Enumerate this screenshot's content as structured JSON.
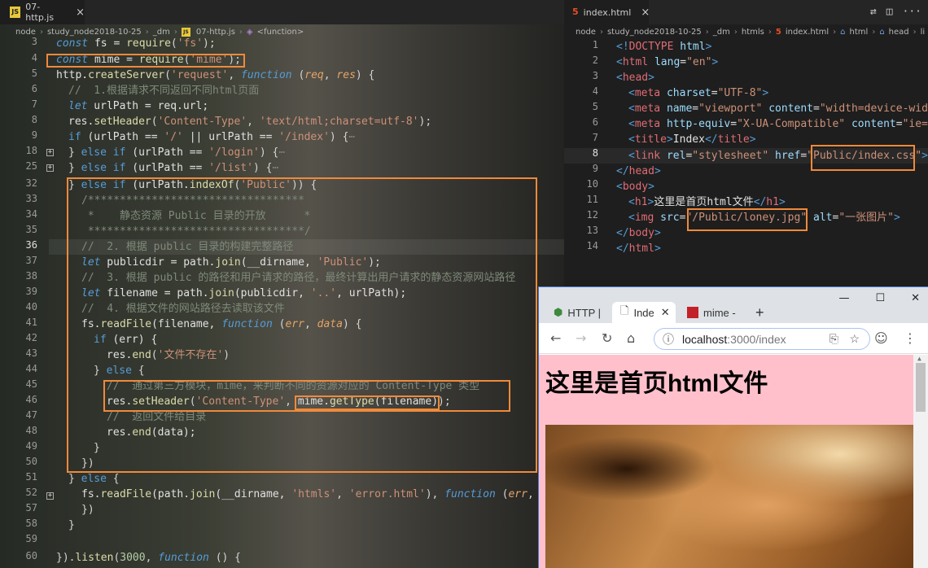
{
  "left_editor": {
    "tab": {
      "icon": "JS",
      "label": "07-http.js",
      "close": "×"
    },
    "breadcrumb": [
      "node",
      "study_node2018-10-25",
      "_dm",
      "07-http.js",
      "<function>"
    ],
    "lines": [
      {
        "n": "3"
      },
      {
        "n": "4"
      },
      {
        "n": "5"
      },
      {
        "n": "6"
      },
      {
        "n": "7"
      },
      {
        "n": "8"
      },
      {
        "n": "9"
      },
      {
        "n": "18"
      },
      {
        "n": "25"
      },
      {
        "n": "32"
      },
      {
        "n": "33"
      },
      {
        "n": "34"
      },
      {
        "n": "35"
      },
      {
        "n": "36"
      },
      {
        "n": "37"
      },
      {
        "n": "38"
      },
      {
        "n": "39"
      },
      {
        "n": "40"
      },
      {
        "n": "41"
      },
      {
        "n": "42"
      },
      {
        "n": "43"
      },
      {
        "n": "44"
      },
      {
        "n": "45"
      },
      {
        "n": "46"
      },
      {
        "n": "47"
      },
      {
        "n": "48"
      },
      {
        "n": "49"
      },
      {
        "n": "50"
      },
      {
        "n": "51"
      },
      {
        "n": "52"
      },
      {
        "n": "57"
      },
      {
        "n": "58"
      },
      {
        "n": "59"
      },
      {
        "n": "60"
      }
    ],
    "code": {
      "l3": [
        "const",
        " fs = ",
        "require",
        "(",
        "'fs'",
        ");"
      ],
      "l4": [
        "const",
        " mime = ",
        "require",
        "(",
        "'mime'",
        ");"
      ],
      "l5": [
        "http.",
        "createServer",
        "(",
        "'request'",
        ", ",
        "function",
        " (",
        "req",
        ", ",
        "res",
        ") {"
      ],
      "l6": "//  1.根据请求不同返回不同html页面",
      "l7": [
        "let",
        " urlPath = req.url;"
      ],
      "l8": [
        "res.",
        "setHeader",
        "(",
        "'Content-Type'",
        ", ",
        "'text/html;charset=utf-8'",
        ");"
      ],
      "l9": [
        "if",
        " (urlPath == ",
        "'/'",
        " || urlPath == ",
        "'/index'",
        ") {",
        "⋯"
      ],
      "l18": [
        "} ",
        "else if",
        " (urlPath == ",
        "'/login'",
        ") {",
        "⋯"
      ],
      "l25": [
        "} ",
        "else if",
        " (urlPath == ",
        "'/list'",
        ") {",
        "⋯"
      ],
      "l32": [
        "} ",
        "else if",
        " (urlPath.",
        "indexOf",
        "(",
        "'Public'",
        ")) {"
      ],
      "l33": "/**********************************",
      "l34": " *    静态资源 Public 目录的开放      *",
      "l35": " **********************************/",
      "l36": "//  2. 根据 public 目录的构建完整路径",
      "l37": [
        "let",
        " publicdir = path.",
        "join",
        "(__dirname, ",
        "'Public'",
        ");"
      ],
      "l38": "//  3. 根据 public 的路径和用户请求的路径，最终计算出用户请求的静态资源网站路径",
      "l39": [
        "let",
        " filename = path.",
        "join",
        "(publicdir, ",
        "'..'",
        ", urlPath);"
      ],
      "l40": "//  4. 根据文件的网站路径去读取该文件",
      "l41": [
        "fs.",
        "readFile",
        "(filename, ",
        "function",
        " (",
        "err",
        ", ",
        "data",
        ") {"
      ],
      "l42": [
        "if",
        " (err) {"
      ],
      "l43": [
        "res.",
        "end",
        "(",
        "'文件不存在'",
        ")"
      ],
      "l44": [
        "} ",
        "else",
        " {"
      ],
      "l45": "//  通过第三方模块，mime，来判断不同的资源对应的 Content-Type 类型",
      "l46": [
        "res.",
        "setHeader",
        "(",
        "'Content-Type'",
        ", ",
        "mime.",
        "getType",
        "(filename)",
        ");"
      ],
      "l47": "//  返回文件给目录",
      "l48": [
        "res.",
        "end",
        "(data);"
      ],
      "l49": "}",
      "l50": "})",
      "l51": [
        "} ",
        "else",
        " {"
      ],
      "l52": [
        "fs.",
        "readFile",
        "(path.",
        "join",
        "(__dirname, ",
        "'htmls'",
        ", ",
        "'error.html'",
        "), ",
        "function",
        " (",
        "err",
        ","
      ],
      "l57": "})",
      "l58": "}",
      "l59": "",
      "l60": [
        "}).",
        "listen",
        "(",
        "3000",
        ", ",
        "function",
        " () {"
      ]
    }
  },
  "right_editor": {
    "tab": {
      "icon": "5",
      "label": "index.html",
      "close": "×"
    },
    "breadcrumb": [
      "node",
      "study_node2018-10-25",
      "_dm",
      "htmls",
      "index.html",
      "html",
      "head",
      "li"
    ],
    "lines": [
      "1",
      "2",
      "3",
      "4",
      "5",
      "6",
      "7",
      "8",
      "9",
      "10",
      "11",
      "12",
      "13",
      "14"
    ],
    "code": {
      "l1": [
        "<!",
        "DOCTYPE",
        " html",
        ">"
      ],
      "l2": [
        "<",
        "html",
        " lang",
        "=",
        "\"en\"",
        ">"
      ],
      "l3": [
        "<",
        "head",
        ">"
      ],
      "l4": [
        "<",
        "meta",
        " charset",
        "=",
        "\"UTF-8\"",
        ">"
      ],
      "l5": [
        "<",
        "meta",
        " name",
        "=",
        "\"viewport\"",
        " content",
        "=",
        "\"width=device-wid"
      ],
      "l6": [
        "<",
        "meta",
        " http-equiv",
        "=",
        "\"X-UA-Compatible\"",
        " content",
        "=",
        "\"ie=e"
      ],
      "l7": [
        "<",
        "title",
        ">",
        "Index",
        "</",
        "title",
        ">"
      ],
      "l8": [
        "<",
        "link",
        " rel",
        "=",
        "\"stylesheet\"",
        " href",
        "=",
        "\"",
        "Public/index.css",
        "\"",
        ">"
      ],
      "l9": [
        "</",
        "head",
        ">"
      ],
      "l10": [
        "<",
        "body",
        ">"
      ],
      "l11": [
        "<",
        "h1",
        ">",
        "这里是首页html文件",
        "</",
        "h1",
        ">"
      ],
      "l12": [
        "<",
        "img",
        " src",
        "=",
        "\"/Public/loney.jpg\"",
        " alt",
        "=",
        "\"一张图片\"",
        ">"
      ],
      "l13": [
        "</",
        "body",
        ">"
      ],
      "l14": [
        "</",
        "html",
        ">"
      ]
    }
  },
  "browser": {
    "tabs": [
      {
        "label": "HTTP |",
        "icon": "cube"
      },
      {
        "label": "Inde",
        "icon": "page"
      },
      {
        "label": "mime -",
        "icon": "npm"
      }
    ],
    "new_tab": "+",
    "window_controls": [
      "—",
      "☐",
      "✕"
    ],
    "url_host": "localhost",
    "url_path": ":3000/index",
    "page_heading": "这里是首页html文件",
    "photo_alt": "一张图片"
  },
  "colors": {
    "highlight_box": "#f08a3a",
    "page_bg": "#ffc0cb"
  }
}
